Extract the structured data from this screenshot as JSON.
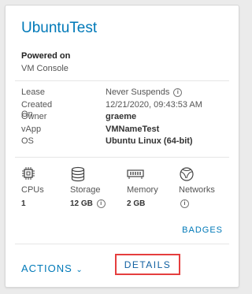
{
  "card": {
    "title": "UbuntuTest",
    "status": "Powered on",
    "console": "VM Console"
  },
  "properties": [
    {
      "label": "Lease",
      "value": "Never Suspends",
      "bold": false,
      "info": true
    },
    {
      "label": "Created On",
      "value": "12/21/2020, 09:43:53 AM",
      "bold": false,
      "info": false
    },
    {
      "label": "Owner",
      "value": "graeme",
      "bold": true,
      "info": false
    },
    {
      "label": "vApp",
      "value": "VMNameTest",
      "bold": true,
      "info": false
    },
    {
      "label": "OS",
      "value": "Ubuntu Linux (64-bit)",
      "bold": true,
      "info": false
    }
  ],
  "resources": [
    {
      "icon": "cpu-icon",
      "label": "CPUs",
      "value": "1",
      "info": false
    },
    {
      "icon": "storage-icon",
      "label": "Storage",
      "value": "12 GB",
      "info": true
    },
    {
      "icon": "memory-icon",
      "label": "Memory",
      "value": "2 GB",
      "info": false
    },
    {
      "icon": "network-icon",
      "label": "Networks",
      "value": "",
      "info": true
    }
  ],
  "footer": {
    "badges_label": "BADGES",
    "actions_label": "ACTIONS",
    "details_label": "DETAILS"
  },
  "colors": {
    "link": "#0079b8",
    "highlight": "#e53e3e"
  }
}
